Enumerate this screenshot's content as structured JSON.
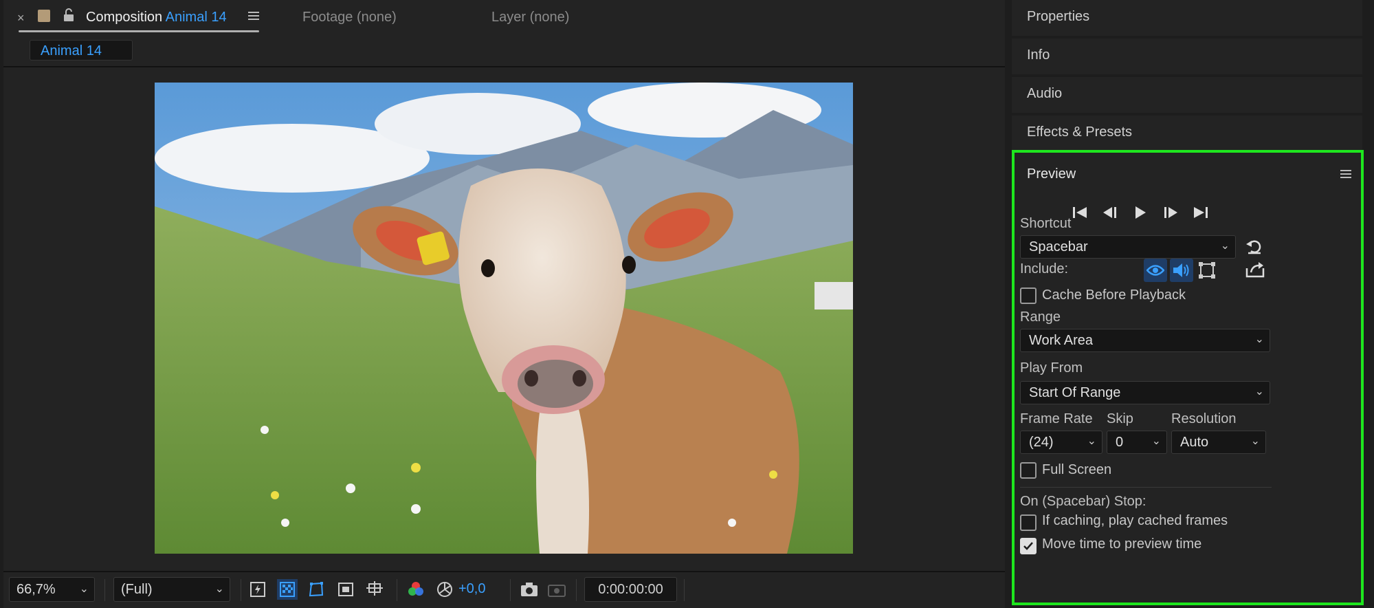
{
  "composition": {
    "tabs": [
      {
        "close": "×",
        "prefix": "Composition",
        "name": "Animal 14"
      },
      {
        "label": "Footage (none)"
      },
      {
        "label": "Layer (none)"
      }
    ],
    "breadcrumb": "Animal 14",
    "image_description_name": "cow-photo",
    "footer": {
      "zoom": "66,7%",
      "resolution": "(Full)",
      "exposure": "+0,0",
      "timecode": "0:00:00:00"
    }
  },
  "right_panels": [
    "Properties",
    "Info",
    "Audio",
    "Effects & Presets"
  ],
  "preview": {
    "title": "Preview",
    "shortcut_label": "Shortcut",
    "shortcut_value": "Spacebar",
    "include_label": "Include:",
    "cache_before_playback": {
      "label": "Cache Before Playback",
      "checked": false
    },
    "range_label": "Range",
    "range_value": "Work Area",
    "play_from_label": "Play From",
    "play_from_value": "Start Of Range",
    "frame_rate_label": "Frame Rate",
    "frame_rate_value": "(24)",
    "skip_label": "Skip",
    "skip_value": "0",
    "resolution_label": "Resolution",
    "resolution_value": "Auto",
    "full_screen": {
      "label": "Full Screen",
      "checked": false
    },
    "on_stop_label": "On (Spacebar) Stop:",
    "if_caching": {
      "label": "If caching, play cached frames",
      "checked": false
    },
    "move_time": {
      "label": "Move time to preview time",
      "checked": true
    }
  },
  "colors": {
    "accent": "#3aa0ff",
    "highlight_border": "#1ee61e",
    "panel_bg": "#232323"
  }
}
